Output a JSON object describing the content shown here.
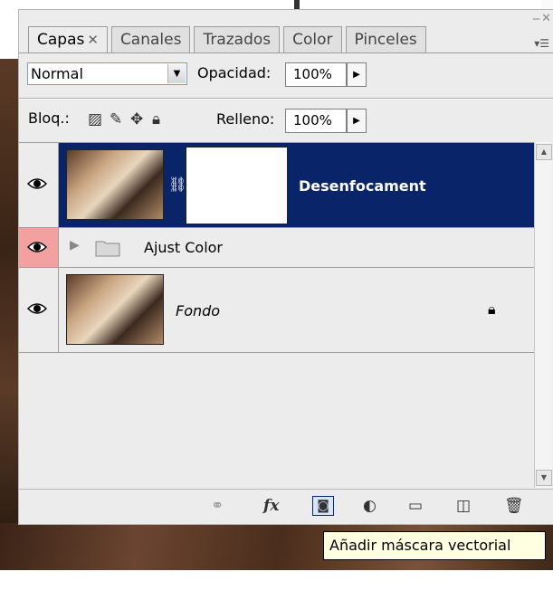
{
  "tabs": [
    {
      "label": "Capas",
      "close": "✕"
    },
    {
      "label": "Canales"
    },
    {
      "label": "Trazados"
    },
    {
      "label": "Color"
    },
    {
      "label": "Pinceles"
    }
  ],
  "blend_mode": "Normal",
  "opacity": {
    "label": "Opacidad:",
    "value": "100%"
  },
  "lock": {
    "label": "Bloq.:"
  },
  "fill": {
    "label": "Relleno:",
    "value": "100%"
  },
  "layers": [
    {
      "name": "Desenfocament",
      "visible": true,
      "selected": true,
      "has_mask": true
    },
    {
      "name": "Ajust Color",
      "visible": true,
      "type": "group",
      "eye_highlight": "#f2a0a0"
    },
    {
      "name": "Fondo",
      "visible": true,
      "locked": true
    }
  ],
  "toolbar_icons": [
    "link-icon",
    "fx-icon",
    "add-vector-mask-icon",
    "adjustment-layer-icon",
    "new-group-icon",
    "new-layer-icon",
    "trash-icon"
  ],
  "fx_label": "fx",
  "tooltip": "Añadir máscara vectorial",
  "colors": {
    "selected_row": "#0a246a",
    "panel_bg": "#ececec",
    "tooltip_bg": "#ffffe1"
  }
}
